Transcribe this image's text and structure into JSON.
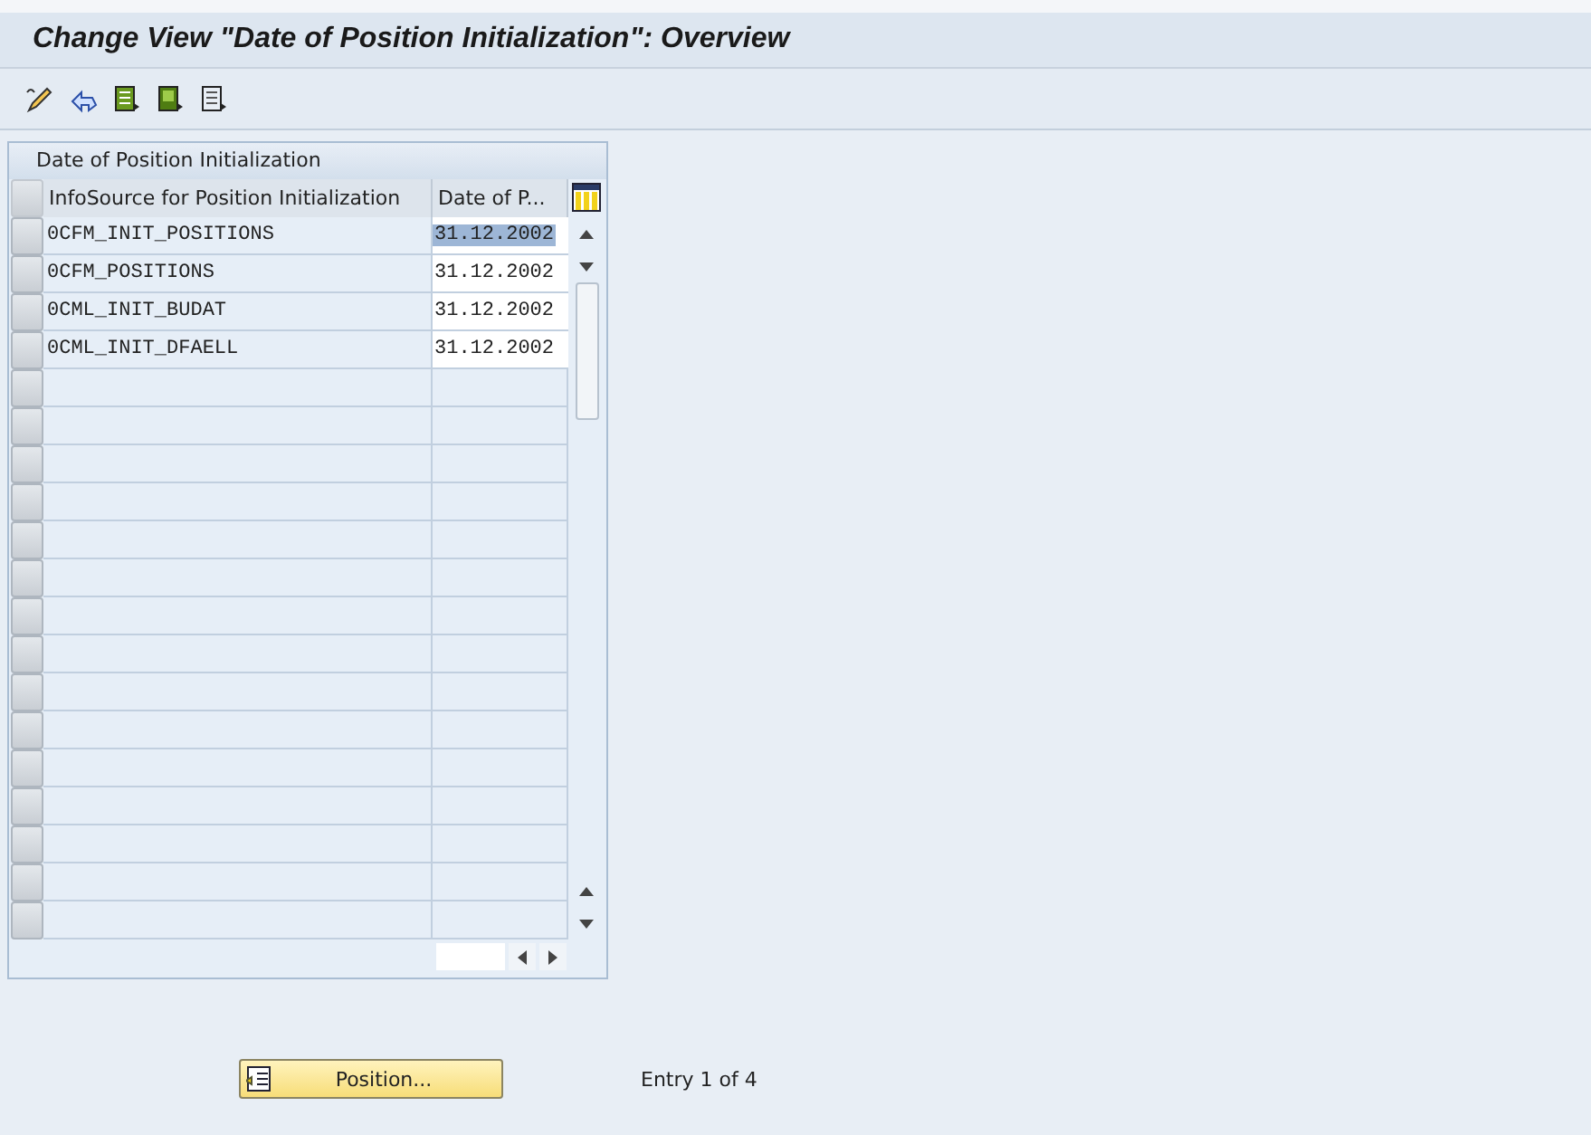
{
  "window": {
    "title": "Change View \"Date of Position Initialization\": Overview"
  },
  "table": {
    "title": "Date of Position Initialization",
    "columns": [
      "InfoSource for Position Initialization",
      "Date of P..."
    ],
    "rows": [
      {
        "infosource": "0CFM_INIT_POSITIONS",
        "date": "31.12.2002",
        "selected": true
      },
      {
        "infosource": "0CFM_POSITIONS",
        "date": "31.12.2002",
        "selected": false
      },
      {
        "infosource": "0CML_INIT_BUDAT",
        "date": "31.12.2002",
        "selected": false
      },
      {
        "infosource": "0CML_INIT_DFAELL",
        "date": "31.12.2002",
        "selected": false
      }
    ]
  },
  "position_button": "Position...",
  "entry_info": "Entry 1 of 4"
}
